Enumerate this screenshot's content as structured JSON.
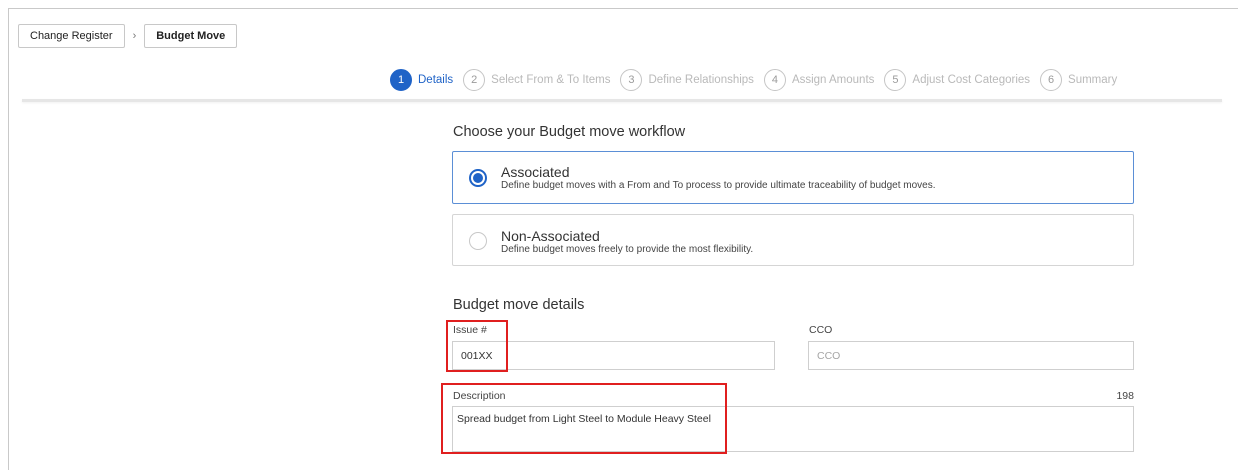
{
  "breadcrumb": {
    "items": [
      "Change Register",
      "Budget Move"
    ],
    "separator": "›"
  },
  "stepper": {
    "active_color": "#1f63c7",
    "steps": [
      {
        "num": "1",
        "label": "Details",
        "active": true
      },
      {
        "num": "2",
        "label": "Select From & To Items",
        "active": false
      },
      {
        "num": "3",
        "label": "Define Relationships",
        "active": false
      },
      {
        "num": "4",
        "label": "Assign Amounts",
        "active": false
      },
      {
        "num": "5",
        "label": "Adjust Cost Categories",
        "active": false
      },
      {
        "num": "6",
        "label": "Summary",
        "active": false
      }
    ]
  },
  "workflow": {
    "heading": "Choose your Budget move workflow",
    "options": [
      {
        "title": "Associated",
        "description": "Define budget moves with a From and To process to provide ultimate traceability of budget moves.",
        "selected": true
      },
      {
        "title": "Non-Associated",
        "description": "Define budget moves freely to provide the most flexibility.",
        "selected": false
      }
    ]
  },
  "details": {
    "heading": "Budget move details",
    "issue": {
      "label": "Issue #",
      "value": "001XX"
    },
    "cco": {
      "label": "CCO",
      "placeholder": "CCO",
      "value": ""
    },
    "description": {
      "label": "Description",
      "value": "Spread budget from Light Steel to Module Heavy Steel",
      "remaining": "198"
    }
  },
  "annotation_color": "#e01f1f"
}
